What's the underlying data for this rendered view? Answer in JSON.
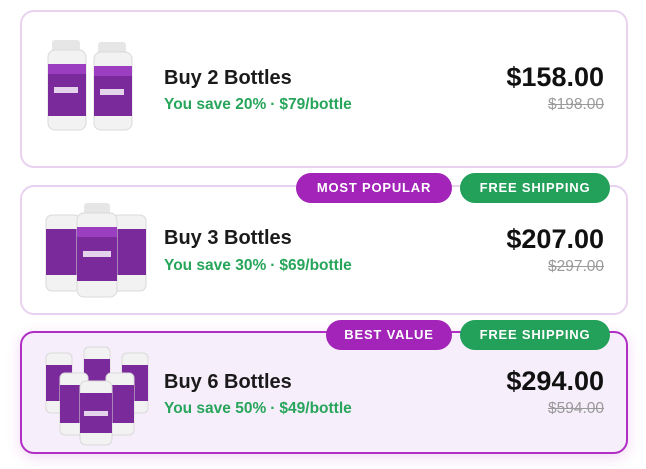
{
  "offers": [
    {
      "title": "Buy 2 Bottles",
      "savings": "You save 20%",
      "separator": "·",
      "per_bottle": "$79/bottle",
      "price": "$158.00",
      "original_price": "$198.00",
      "image": "slim-bottles-2-pack",
      "badges": []
    },
    {
      "title": "Buy 3 Bottles",
      "savings": "You save 30%",
      "separator": "·",
      "per_bottle": "$69/bottle",
      "price": "$207.00",
      "original_price": "$297.00",
      "image": "slim-bottles-3-pack",
      "badges": [
        "MOST POPULAR",
        "FREE SHIPPING"
      ]
    },
    {
      "title": "Buy 6 Bottles",
      "savings": "You save 50%",
      "separator": "·",
      "per_bottle": "$49/bottle",
      "price": "$294.00",
      "original_price": "$594.00",
      "image": "slim-bottles-6-pack",
      "badges": [
        "BEST VALUE",
        "FREE SHIPPING"
      ],
      "selected": true
    }
  ],
  "colors": {
    "accent_purple": "#a324b8",
    "savings_green": "#27a55a",
    "badge_green": "#23a05a",
    "card_border": "#e8d2f0",
    "selected_border": "#b02ec4",
    "selected_background": "#f7eefb"
  }
}
